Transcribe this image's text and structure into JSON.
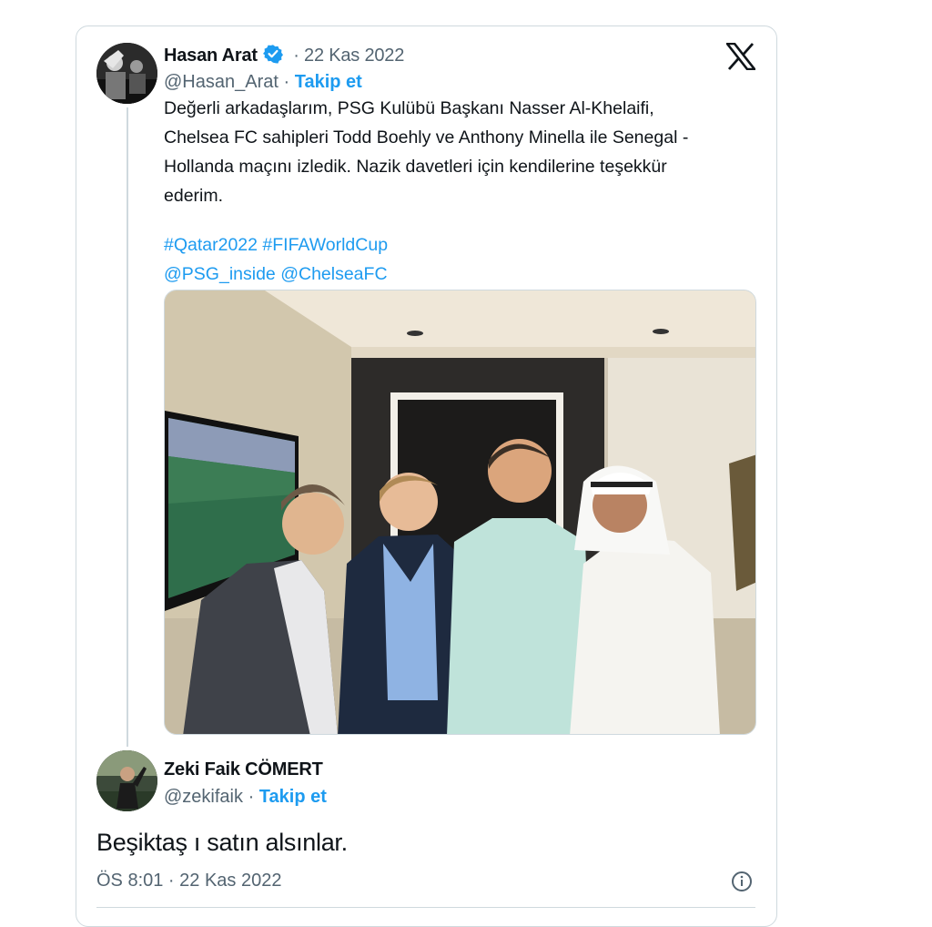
{
  "quoted_tweet": {
    "author_name": "Hasan Arat",
    "dot_date": "· 22 Kas 2022",
    "handle": "@Hasan_Arat",
    "separator": "·",
    "follow_label": "Takip et",
    "lines": [
      "Değerli arkadaşlarım, PSG Kulübü Başkanı Nasser Al-Khelaifi,",
      "Chelsea FC sahipleri Todd Boehly ve Anthony Minella ile Senegal -",
      "Hollanda maçını izledik. Nazik davetleri için kendilerine teşekkür",
      "ederim."
    ],
    "hashtags": "#Qatar2022 #FIFAWorldCup",
    "mentions": "@PSG_inside @ChelseaFC"
  },
  "reply_tweet": {
    "author_name": "Zeki Faik CÖMERT",
    "handle": "@zekifaik",
    "separator": "·",
    "follow_label": "Takip et",
    "text": "Beşiktaş ı satın alsınlar.",
    "timestamp": "ÖS 8:01 · 22 Kas 2022"
  },
  "icons": {
    "verified": "verified-badge-icon",
    "platform": "x-logo-icon",
    "info": "info-icon"
  },
  "colors": {
    "link": "#1d9bf0",
    "muted": "#536471",
    "border": "#cfd9de"
  }
}
